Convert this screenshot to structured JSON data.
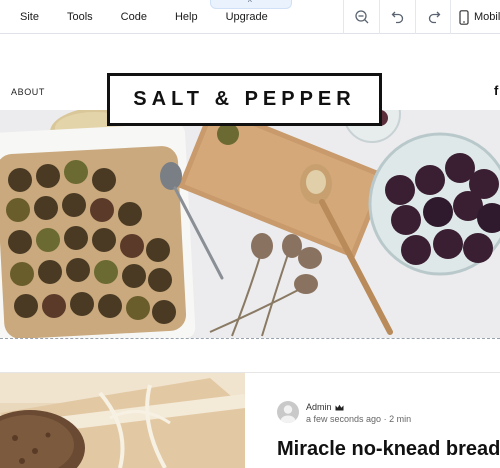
{
  "editor": {
    "menu": [
      {
        "label": "Site"
      },
      {
        "label": "Tools"
      },
      {
        "label": "Code"
      },
      {
        "label": "Help"
      },
      {
        "label": "Upgrade"
      }
    ],
    "tools": [
      {
        "icon": "zoom-out-icon"
      },
      {
        "icon": "undo-icon"
      },
      {
        "icon": "redo-icon"
      }
    ],
    "device_label": "Mobile",
    "device_icon": "mobile-phone-icon"
  },
  "site": {
    "nav_about": "ABOUT",
    "logo_text": "SALT & PEPPER",
    "social_icon": "facebook-icon",
    "social_glyph": "f"
  },
  "post": {
    "author": "Admin",
    "author_badge": "crown-icon",
    "time_ago": "a few seconds ago",
    "separator": "·",
    "read_time": "2 min",
    "title": "Miracle no-knead bread"
  },
  "colors": {
    "toolbar_border": "#dfe3e8",
    "logo_border": "#111111",
    "dashed_guide": "#9aa3ad"
  }
}
